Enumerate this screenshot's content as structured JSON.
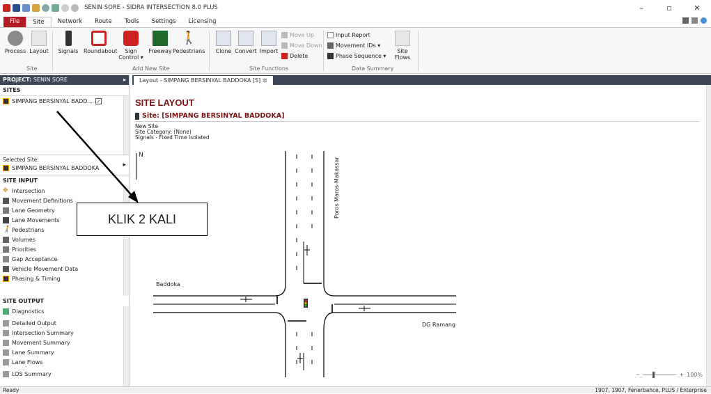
{
  "window": {
    "title": "SENIN SORE - SIDRA INTERSECTION 8.0 PLUS",
    "min": "–",
    "max": "▫",
    "close": "✕"
  },
  "ribbon_tabs": [
    "File",
    "Site",
    "Network",
    "Route",
    "Tools",
    "Settings",
    "Licensing"
  ],
  "ribbon": {
    "process": "Process",
    "layout": "Layout",
    "signals": "Signals",
    "roundabout": "Roundabout",
    "sign_control": "Sign Control ▾",
    "freeway": "Freeway",
    "pedestrians": "Pedestrians",
    "clone": "Clone",
    "convert": "Convert",
    "import": "Import",
    "move_up": "Move Up",
    "move_down": "Move Down",
    "delete": "Delete",
    "input_report": "Input Report",
    "movement_ids": "Movement IDs ▾",
    "phase_sequence": "Phase Sequence ▾",
    "site_flows": "Site Flows",
    "groups": {
      "site": "Site",
      "add_new_site": "Add New Site",
      "site_functions": "Site Functions",
      "data_summary": "Data Summary"
    }
  },
  "project": {
    "label": "PROJECT:",
    "name": "SENIN SORE"
  },
  "sites": {
    "header": "SITES",
    "item": "SIMPANG BERSINYAL BADD..."
  },
  "selected_site": {
    "label": "Selected Site:",
    "name": "SIMPANG BERSINYAL BADDOKA"
  },
  "site_input": {
    "header": "SITE INPUT",
    "items": [
      "Intersection",
      "Movement Definitions",
      "Lane Geometry",
      "Lane Movements",
      "Pedestrians",
      "Volumes",
      "Priorities",
      "Gap Acceptance",
      "Vehicle Movement Data",
      "Phasing & Timing"
    ]
  },
  "site_output": {
    "header": "SITE OUTPUT",
    "items": [
      "Diagnostics",
      "Detailed Output",
      "Intersection Summary",
      "Movement Summary",
      "Lane Summary",
      "Lane Flows",
      "LOS Summary"
    ]
  },
  "doc_tab": "Layout - SIMPANG BERSINYAL BADDOKA [S]",
  "layout": {
    "heading": "SITE LAYOUT",
    "site_line": "Site:  [SIMPANG BERSINYAL BADDOKA]",
    "meta": [
      "New Site",
      "Site Category: (None)",
      "Signals - Fixed Time Isolated"
    ],
    "north": "N",
    "road_north": "Poros  Maros-Makassar",
    "road_west": "Baddoka",
    "road_east": "DG Ramang"
  },
  "annotation": "KLIK 2 KALI",
  "status": {
    "left": "Ready",
    "right": "1907, 1907, Fenerbahce, PLUS / Enterprise",
    "zoom": "100%"
  },
  "colors": {
    "file_tab": "#b31c25",
    "nav_dark": "#3c4654",
    "heading": "#7a1414"
  }
}
